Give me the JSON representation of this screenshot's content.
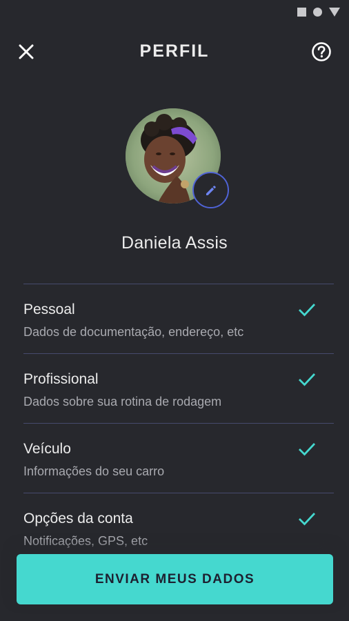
{
  "status_bar": {
    "icons": [
      "square-icon",
      "circle-icon",
      "triangle-icon"
    ]
  },
  "header": {
    "title": "PERFIL",
    "close_icon": "close-icon",
    "help_icon": "help-icon"
  },
  "profile": {
    "name": "Daniela Assis",
    "edit_icon": "pencil-icon"
  },
  "menu": {
    "items": [
      {
        "title": "Pessoal",
        "subtitle": "Dados de documentação, endereço, etc",
        "completed": true
      },
      {
        "title": "Profissional",
        "subtitle": "Dados sobre sua rotina de rodagem",
        "completed": true
      },
      {
        "title": "Veículo",
        "subtitle": "Informações do seu carro",
        "completed": true
      },
      {
        "title": "Opções da conta",
        "subtitle": "Notificações, GPS, etc",
        "completed": true
      }
    ]
  },
  "actions": {
    "submit_label": "ENVIAR MEUS DADOS"
  },
  "colors": {
    "background": "#27282d",
    "accent": "#45d8cf",
    "edit_ring": "#4f63d6",
    "divider": "#474b6e"
  }
}
